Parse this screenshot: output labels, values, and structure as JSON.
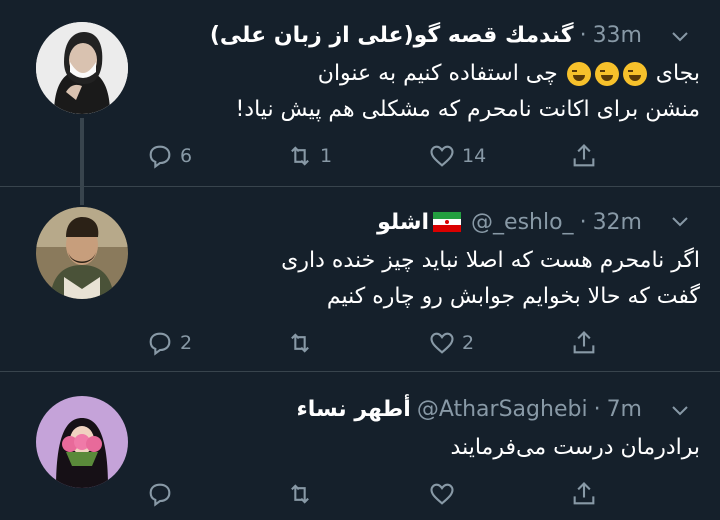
{
  "tweets": [
    {
      "name": "گندمك قصه گو(على از زبان على)",
      "handle": "",
      "time": "33m",
      "text_line1_before": "بجای",
      "text_line1_after": "چی استفاده کنیم به عنوان",
      "text_line2": "منشن برای اکانت نامحرم که مشکلی هم پیش نیاد!",
      "emoji": "face-with-tears-of-joy",
      "emoji_count": 3,
      "reply_count": "6",
      "retweet_count": "1",
      "like_count": "14"
    },
    {
      "name": "اشلو",
      "handle": "@_eshlo_",
      "time": "32m",
      "text_line1": "اگر نامحرم هست که اصلا نباید چیز خنده داری",
      "text_line2": "گفت که حالا بخوایم جوابش رو چاره کنیم",
      "reply_count": "2",
      "retweet_count": "",
      "like_count": "2"
    },
    {
      "name": "أطهر نساء",
      "handle": "@AtharSaghebi",
      "time": "7m",
      "text_line1": "برادرمان درست می‌فرمایند",
      "reply_count": "",
      "retweet_count": "",
      "like_count": ""
    }
  ],
  "icons": {
    "reply": "reply-icon",
    "retweet": "retweet-icon",
    "like": "heart-icon",
    "share": "share-icon",
    "more": "chevron-down-icon"
  },
  "colors": {
    "background": "#15202b",
    "muted_text": "#8899a6",
    "divider": "#38444d"
  }
}
